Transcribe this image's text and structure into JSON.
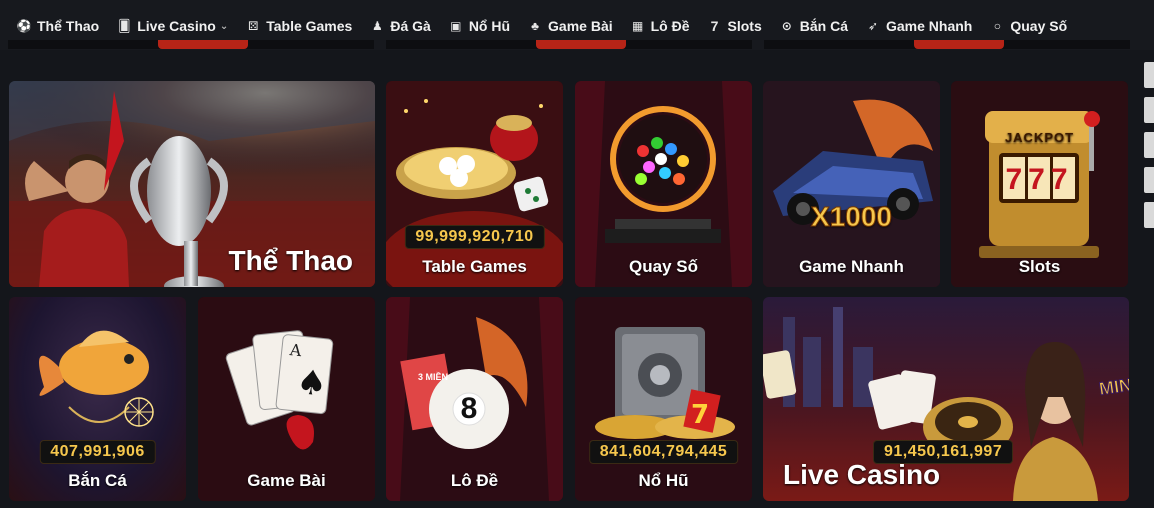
{
  "nav": {
    "items": [
      {
        "label": "Thể Thao",
        "icon": "soccer-ball-icon",
        "glyph": "⚽"
      },
      {
        "label": "Live Casino",
        "icon": "card-icon",
        "glyph": "🂠",
        "dropdown": true
      },
      {
        "label": "Table Games",
        "icon": "dice-icon",
        "glyph": "⚄"
      },
      {
        "label": "Đá Gà",
        "icon": "rooster-icon",
        "glyph": "♟"
      },
      {
        "label": "Nổ Hũ",
        "icon": "slot-machine-icon",
        "glyph": "▣"
      },
      {
        "label": "Game Bài",
        "icon": "club-icon",
        "glyph": "♣"
      },
      {
        "label": "Lô Đề",
        "icon": "lottery-icon",
        "glyph": "▦"
      },
      {
        "label": "Slots",
        "icon": "seven-icon",
        "glyph": "7"
      },
      {
        "label": "Bắn Cá",
        "icon": "target-icon",
        "glyph": "⊙"
      },
      {
        "label": "Game Nhanh",
        "icon": "rocket-icon",
        "glyph": "➶"
      },
      {
        "label": "Quay Số",
        "icon": "circle-icon",
        "glyph": "○"
      }
    ]
  },
  "tiles": {
    "the_thao": {
      "label": "Thể Thao"
    },
    "table_games": {
      "label": "Table Games",
      "jackpot": "99,999,920,710"
    },
    "quay_so": {
      "label": "Quay Số"
    },
    "game_nhanh": {
      "label": "Game Nhanh",
      "multiplier": "X1000"
    },
    "slots": {
      "label": "Slots",
      "sign": "JACKPOT",
      "reels": "777"
    },
    "ban_ca": {
      "label": "Bắn Cá",
      "jackpot": "407,991,906"
    },
    "game_bai": {
      "label": "Game Bài"
    },
    "lo_de": {
      "label": "Lô Đề",
      "ball": "8",
      "ticket": "3 MIỀN"
    },
    "no_hu": {
      "label": "Nổ Hũ",
      "jackpot": "841,604,794,445"
    },
    "live_casino": {
      "label": "Live Casino",
      "jackpot": "91,450,161,997",
      "logo": "MIN GAME"
    }
  },
  "colors": {
    "accent": "#b72417",
    "jackpot_text": "#f6c74d",
    "nav_bg": "#17191e"
  }
}
